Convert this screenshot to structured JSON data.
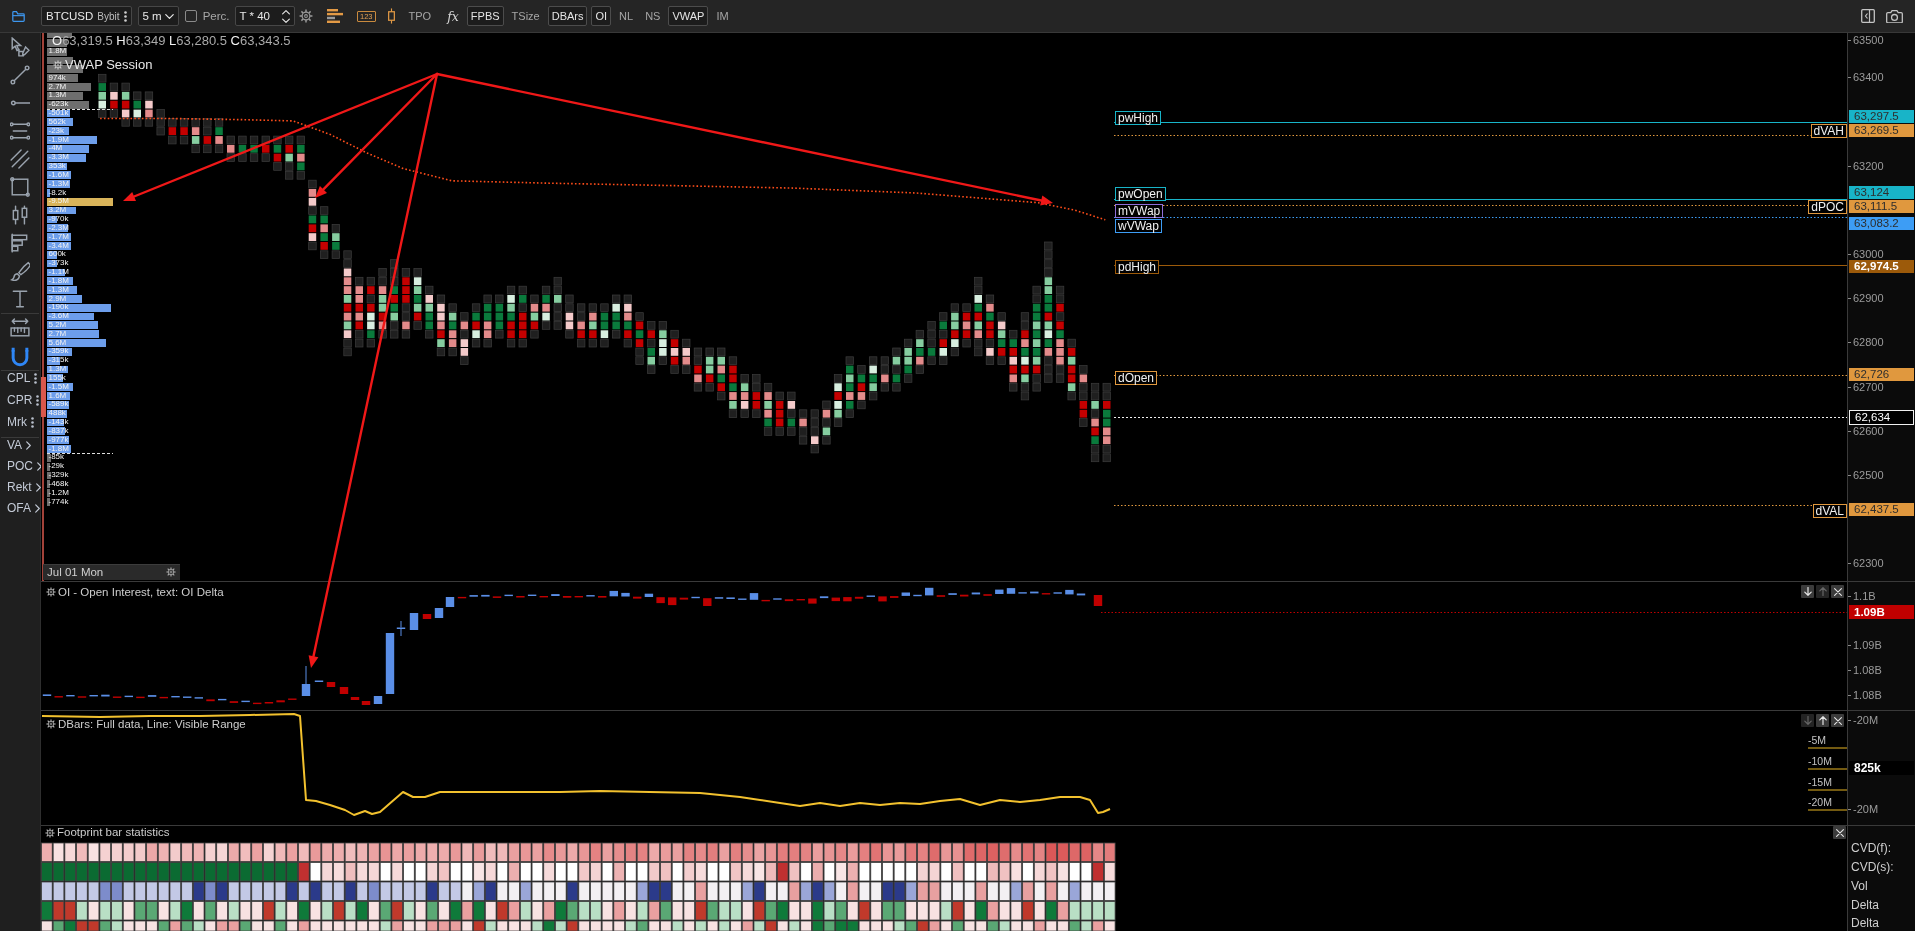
{
  "toolbar": {
    "symbol": "BTCUSD",
    "exchange": "Bybit",
    "timeframe": "5 m",
    "percent": {
      "label": "Perc.",
      "checked": false
    },
    "aggregation": "T * 40",
    "format_label": "123",
    "toggles": [
      {
        "label": "TPO",
        "kind": "text",
        "on": false
      },
      {
        "label": "fx",
        "kind": "formula",
        "on": false
      },
      {
        "label": "FPBS",
        "kind": "text",
        "on": true
      },
      {
        "label": "TSize",
        "kind": "text",
        "on": false
      },
      {
        "label": "DBArs",
        "kind": "text",
        "on": true
      },
      {
        "label": "OI",
        "kind": "text",
        "on": true
      },
      {
        "label": "NL",
        "kind": "text",
        "on": false
      },
      {
        "label": "NS",
        "kind": "text",
        "on": false
      },
      {
        "label": "VWAP",
        "kind": "text",
        "on": true
      },
      {
        "label": "IM",
        "kind": "text",
        "on": false
      }
    ]
  },
  "side_toolbar": {
    "magnet_on": true,
    "panels": [
      {
        "label": "CPL"
      },
      {
        "label": "CPR"
      },
      {
        "label": "Mrk"
      }
    ],
    "menus": [
      {
        "label": "VA"
      },
      {
        "label": "POC"
      },
      {
        "label": "Rekt"
      },
      {
        "label": "OFA"
      }
    ]
  },
  "price_pane": {
    "ohlc": [
      {
        "key": "O",
        "value": "63,319.5"
      },
      {
        "key": "H",
        "value": "63,349"
      },
      {
        "key": "L",
        "value": "63,280.5"
      },
      {
        "key": "C",
        "value": "63,343.5"
      }
    ],
    "indicator": "VWAP Session",
    "volume_profile": [
      {
        "color": "#6e6e6e"
      },
      {
        "color": "#6e6e6e"
      },
      {
        "label": "1.8M",
        "color": "#6e6e6e"
      },
      {
        "color": "#6e6e6e"
      },
      {
        "color": "#6e6e6e"
      },
      {
        "label": "974k",
        "color": "#6e6e6e"
      },
      {
        "label": "2.7M",
        "color": "#6e6e6e"
      },
      {
        "label": "1.3M",
        "color": "#6e6e6e"
      },
      {
        "label": "-623k",
        "color": "#6e6e6e"
      },
      {
        "label": "-501k",
        "color": "#6d9eeb"
      },
      {
        "label": "562k",
        "color": "#6d9eeb"
      },
      {
        "label": "-23k",
        "color": "#6d9eeb"
      },
      {
        "label": "-1.9M",
        "color": "#6d9eeb"
      },
      {
        "label": "-4M",
        "color": "#6d9eeb"
      },
      {
        "label": "-3.3M",
        "color": "#6d9eeb"
      },
      {
        "label": "353k",
        "color": "#6d9eeb"
      },
      {
        "label": "-1.6M",
        "color": "#6d9eeb"
      },
      {
        "label": "-1.3M",
        "color": "#6d9eeb"
      },
      {
        "label": "-8.2k",
        "color": "#6d9eeb"
      },
      {
        "label": "-9.5M",
        "color": "#d9b45a"
      },
      {
        "label": "3.2M",
        "color": "#6d9eeb"
      },
      {
        "label": "-970k",
        "color": "#6d9eeb"
      },
      {
        "label": "-2.3M",
        "color": "#6d9eeb"
      },
      {
        "label": "-1.7M",
        "color": "#6d9eeb"
      },
      {
        "label": "-3.4M",
        "color": "#6d9eeb"
      },
      {
        "label": "600k",
        "color": "#6d9eeb"
      },
      {
        "label": "-373k",
        "color": "#6d9eeb"
      },
      {
        "label": "-1.1M",
        "color": "#6d9eeb"
      },
      {
        "label": "-1.8M",
        "color": "#6d9eeb"
      },
      {
        "label": "-1.3M",
        "color": "#6d9eeb"
      },
      {
        "label": "2.9M",
        "color": "#6d9eeb"
      },
      {
        "label": "-190k",
        "color": "#6d9eeb"
      },
      {
        "label": "-3.6M",
        "color": "#6d9eeb"
      },
      {
        "label": "5.2M",
        "color": "#6d9eeb"
      },
      {
        "label": "2.7M",
        "color": "#6d9eeb"
      },
      {
        "label": "5.6M",
        "color": "#6d9eeb"
      },
      {
        "label": "-359k",
        "color": "#6d9eeb"
      },
      {
        "label": "-315k",
        "color": "#6d9eeb"
      },
      {
        "label": "1.3M",
        "color": "#6d9eeb"
      },
      {
        "label": "155k",
        "color": "#6d9eeb"
      },
      {
        "label": "-1.5M",
        "color": "#6d9eeb"
      },
      {
        "label": "1.6M",
        "color": "#6d9eeb"
      },
      {
        "label": "-589k",
        "color": "#6d9eeb"
      },
      {
        "label": "488k",
        "color": "#6d9eeb"
      },
      {
        "label": "-143k",
        "color": "#6d9eeb"
      },
      {
        "label": "-837k",
        "color": "#6d9eeb"
      },
      {
        "label": "-977k",
        "color": "#6d9eeb"
      },
      {
        "label": "-1.8M",
        "color": "#6d9eeb"
      },
      {
        "label": "-85k",
        "color": "#6e6e6e"
      },
      {
        "label": "-29k",
        "color": "#6e6e6e"
      },
      {
        "label": "-329k",
        "color": "#6e6e6e"
      },
      {
        "label": "-468k",
        "color": "#6e6e6e"
      },
      {
        "label": "-1.2M",
        "color": "#6e6e6e"
      },
      {
        "label": "-774k",
        "color": "#6e6e6e"
      }
    ],
    "levels": [
      {
        "label": "pwHigh",
        "price": "63,297.5",
        "color": "#18b4c8",
        "kind": "solid"
      },
      {
        "label": "dVAH",
        "price": "63,269.5",
        "color": "#e0983e",
        "kind": "value-area"
      },
      {
        "label": "pwOpen",
        "price": "63,124",
        "color": "#18b4c8",
        "kind": "solid"
      },
      {
        "label": "mVWap",
        "color": "#8f6fd9",
        "kind": "label-only"
      },
      {
        "label": "dPOC",
        "price": "63,111.5",
        "color": "#e0983e",
        "kind": "value-area"
      },
      {
        "label": "wVWap",
        "price": "63,083.2",
        "color": "#3d9df5",
        "kind": "dotted"
      },
      {
        "label": "pdHigh",
        "price": "62,974.5",
        "color": "#9c5a0a",
        "kind": "solid"
      },
      {
        "label": "dOpen",
        "price": "62,726",
        "color": "#e0983e",
        "kind": "dotted"
      },
      {
        "label": "dVAL",
        "price": "62,437.5",
        "color": "#e0983e",
        "kind": "value-area"
      }
    ],
    "last_price": "62,634",
    "axis_ticks": [
      "63500",
      "63400",
      "63200",
      "63000",
      "62900",
      "62800",
      "62700",
      "62600",
      "62500",
      "62300"
    ],
    "date_label": "Jul 01 Mon"
  },
  "oi_pane": {
    "title": "OI - Open Interest, text: OI Delta",
    "controls": [
      {
        "kind": "move-down",
        "disabled": false
      },
      {
        "kind": "move-up",
        "disabled": true
      },
      {
        "kind": "close",
        "disabled": false
      }
    ],
    "axis_ticks": [
      "1.1B",
      "1.09B",
      "1.08B",
      "1.08B"
    ],
    "last_value": "1.09B"
  },
  "dbars_pane": {
    "title": "DBars: Full data, Line: Visible Range",
    "controls": [
      {
        "kind": "move-down",
        "disabled": true
      },
      {
        "kind": "move-up",
        "disabled": false
      },
      {
        "kind": "close",
        "disabled": false
      }
    ],
    "axis_ticks": [
      "-20M",
      "-20M"
    ],
    "last_value": "825k",
    "level_labels": [
      "-5M",
      "-10M",
      "-15M",
      "-20M"
    ]
  },
  "stats_pane": {
    "title": "Footprint bar statistics",
    "controls": [
      {
        "kind": "close",
        "disabled": false
      }
    ],
    "row_labels": [
      "CVD(f):",
      "CVD(s):",
      "Vol",
      "Delta",
      "Delta"
    ]
  }
}
